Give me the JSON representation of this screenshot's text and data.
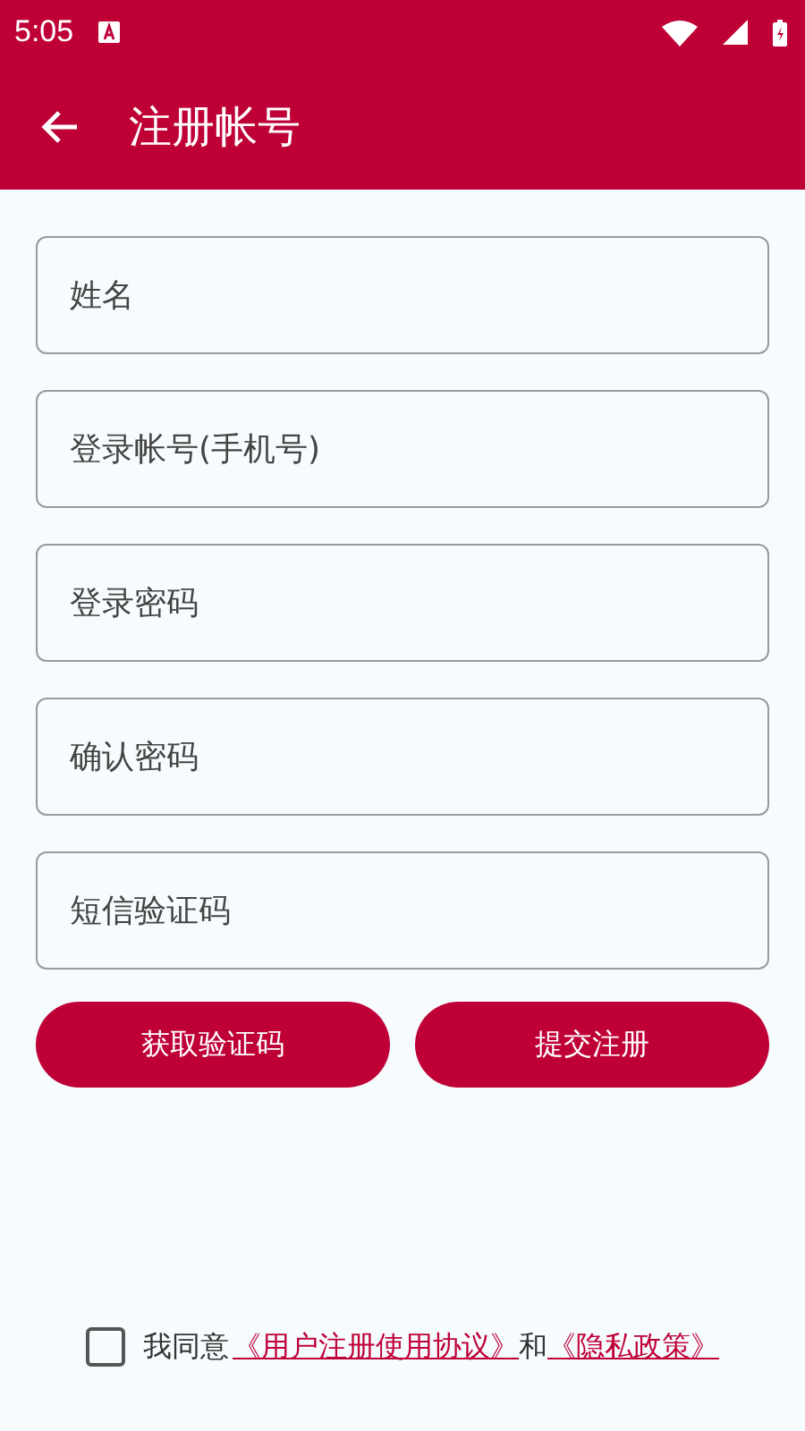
{
  "status_bar": {
    "time": "5:05"
  },
  "app_bar": {
    "title": "注册帐号"
  },
  "fields": [
    {
      "placeholder": "姓名"
    },
    {
      "placeholder": "登录帐号(手机号)"
    },
    {
      "placeholder": "登录密码"
    },
    {
      "placeholder": "确认密码"
    },
    {
      "placeholder": "短信验证码"
    }
  ],
  "buttons": [
    "获取验证码",
    "提交注册"
  ],
  "agreement": {
    "checked": false,
    "prefix": "我同意",
    "links": [
      "《用户注册使用协议》",
      "《隐私政策》"
    ],
    "joiner": "和"
  }
}
